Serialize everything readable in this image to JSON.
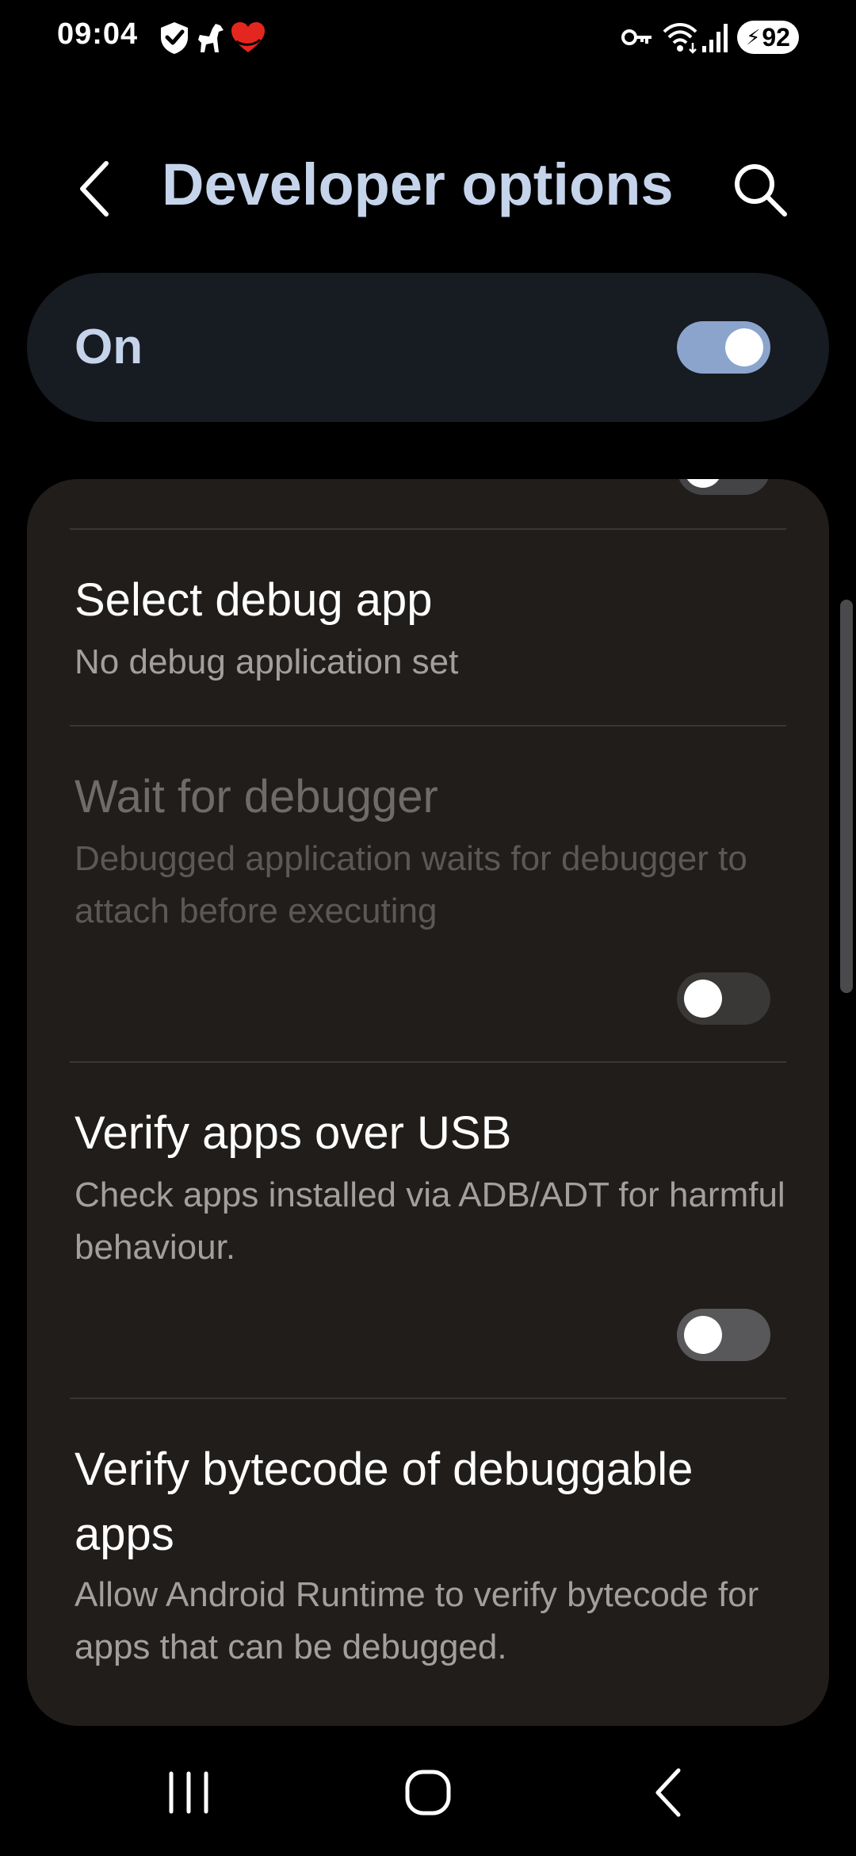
{
  "status_bar": {
    "time": "09:04",
    "left_icons": [
      "shield-check-icon",
      "dog-icon",
      "heart-icon"
    ],
    "right_icons": [
      "vpn-key-icon",
      "wifi-icon",
      "signal-icon"
    ],
    "battery_level": "92",
    "battery_charging": true
  },
  "header": {
    "title": "Developer options",
    "back_icon": "chevron-left-icon",
    "search_icon": "search-icon"
  },
  "master_switch": {
    "label": "On",
    "state": "on"
  },
  "settings": {
    "items": [
      {
        "title": "Select debug app",
        "summary": "No debug application set",
        "enabled": true
      },
      {
        "title": "Wait for debugger",
        "summary": "Debugged application waits for debugger to attach before executing",
        "enabled": false,
        "toggle": "off"
      },
      {
        "title": "Verify apps over USB",
        "summary": "Check apps installed via ADB/ADT for harmful behaviour.",
        "enabled": true,
        "toggle": "off"
      },
      {
        "title": "Verify bytecode of debuggable apps",
        "summary": "Allow Android Runtime to verify bytecode for apps that can be debugged.",
        "enabled": true
      }
    ]
  },
  "nav_bar": {
    "recents_icon": "recents-icon",
    "home_icon": "home-icon",
    "back_icon": "back-icon"
  },
  "colors": {
    "background": "#000000",
    "title_accent": "#c5d4ea",
    "card": "#201d1b",
    "master_card": "#171b22",
    "toggle_on": "#8ba4cc",
    "toggle_off": "#444446",
    "summary_text": "#a39f9c"
  }
}
